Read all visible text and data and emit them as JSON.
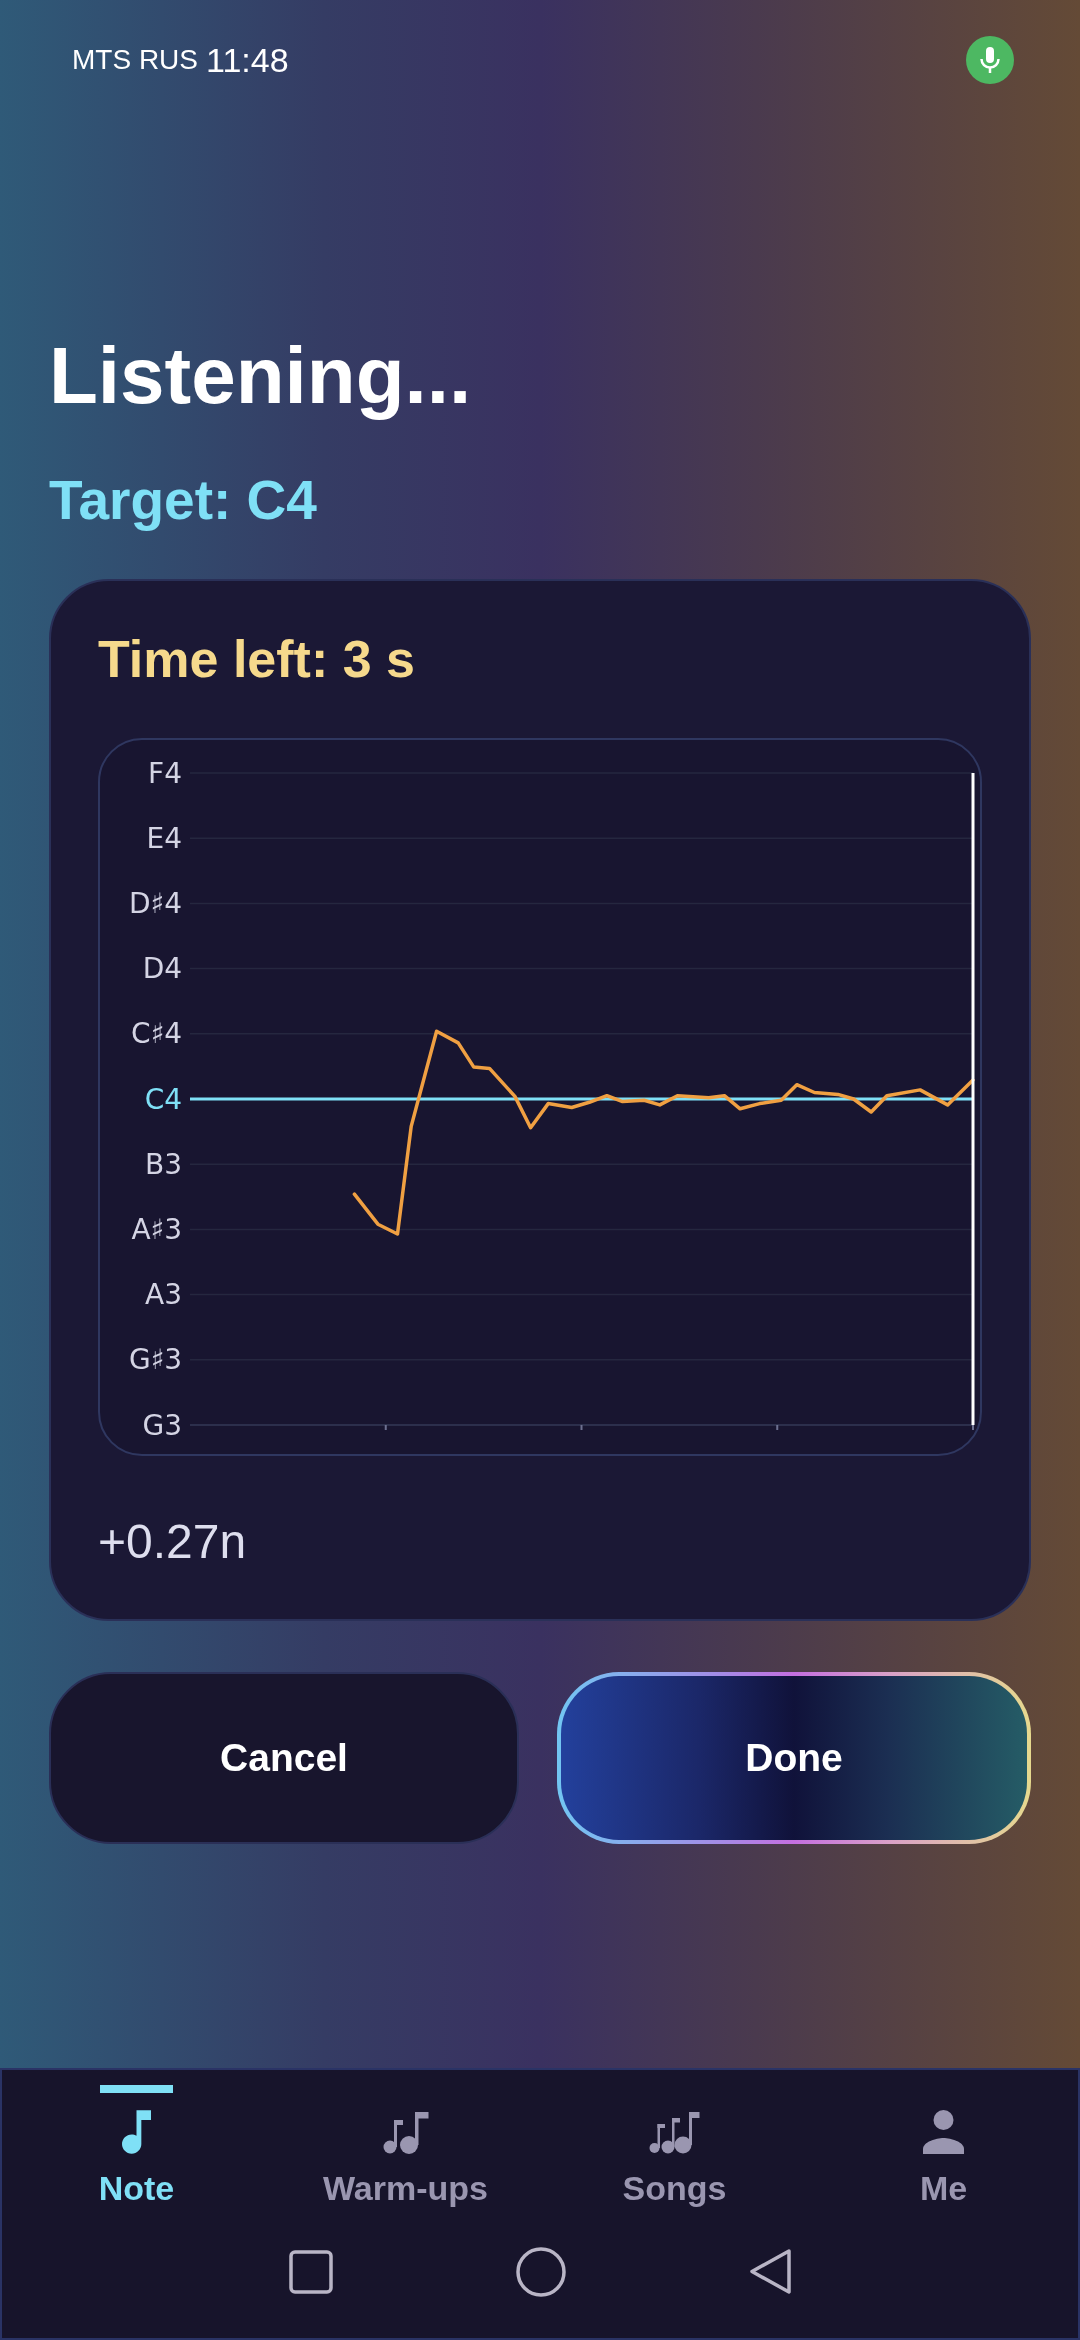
{
  "status_bar": {
    "carrier": "MTS RUS",
    "time": "11:48"
  },
  "header": {
    "title": "Listening...",
    "target": "Target: C4"
  },
  "card": {
    "timer": "Time left: 3 s",
    "pitch_graph": {
      "note_labels": [
        {
          "label": "F4",
          "target": false
        },
        {
          "label": "E4",
          "target": false
        },
        {
          "label": "D♯4",
          "target": false
        },
        {
          "label": "D4",
          "target": false
        },
        {
          "label": "C♯4",
          "target": false
        },
        {
          "label": "C4",
          "target": true
        },
        {
          "label": "B3",
          "target": false
        },
        {
          "label": "A♯3",
          "target": false
        },
        {
          "label": "A3",
          "target": false
        },
        {
          "label": "G♯3",
          "target": false
        },
        {
          "label": "G3",
          "target": false
        }
      ]
    },
    "deviation": "+0.27n"
  },
  "buttons": [
    {
      "label": "Cancel",
      "kind": "secondary"
    },
    {
      "label": "Done",
      "kind": "primary"
    }
  ],
  "bottom_nav": [
    {
      "label": "Note",
      "selected": true
    },
    {
      "label": "Warm-ups",
      "selected": false
    },
    {
      "label": "Songs",
      "selected": false
    },
    {
      "label": "Me",
      "selected": false
    }
  ]
}
